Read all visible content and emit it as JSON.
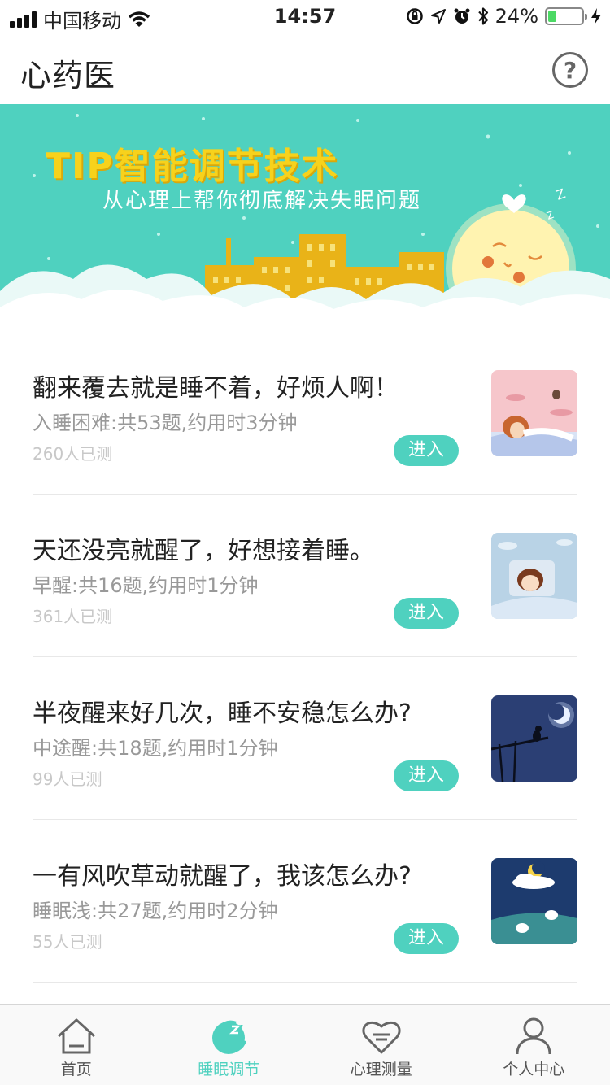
{
  "status_bar": {
    "carrier": "中国移动",
    "time": "14:57",
    "battery_percent": "24%",
    "battery_level": 0.24,
    "icons": [
      "signal-icon",
      "wifi-icon",
      "orientation-lock-icon",
      "location-icon",
      "alarm-icon",
      "bluetooth-icon",
      "battery-icon",
      "charging-icon"
    ]
  },
  "header": {
    "title": "心药医",
    "help_icon": "question-circle-icon"
  },
  "banner": {
    "title": "TIP智能调节技术",
    "subtitle": "从心理上帮你彻底解决失眠问题",
    "colors": {
      "background": "#4fd1bf",
      "title": "#f7d21c",
      "cloud": "#ffffff"
    }
  },
  "items": [
    {
      "title": "翻来覆去就是睡不着，好烦人啊！",
      "desc": "入睡困难:共53题,约用时3分钟",
      "count": "260人已测",
      "button": "进入"
    },
    {
      "title": "天还没亮就醒了，好想接着睡。",
      "desc": "早醒:共16题,约用时1分钟",
      "count": "361人已测",
      "button": "进入"
    },
    {
      "title": "半夜醒来好几次，睡不安稳怎么办?",
      "desc": "中途醒:共18题,约用时1分钟",
      "count": "99人已测",
      "button": "进入"
    },
    {
      "title": "一有风吹草动就醒了，我该怎么办?",
      "desc": "睡眠浅:共27题,约用时2分钟",
      "count": "55人已测",
      "button": "进入"
    }
  ],
  "tabbar": {
    "tabs": [
      {
        "label": "首页",
        "icon": "home-icon",
        "active": false
      },
      {
        "label": "睡眠调节",
        "icon": "sleep-moon-icon",
        "active": true
      },
      {
        "label": "心理测量",
        "icon": "heart-icon",
        "active": false
      },
      {
        "label": "个人中心",
        "icon": "person-icon",
        "active": false
      }
    ],
    "active_color": "#4fd1bf"
  }
}
